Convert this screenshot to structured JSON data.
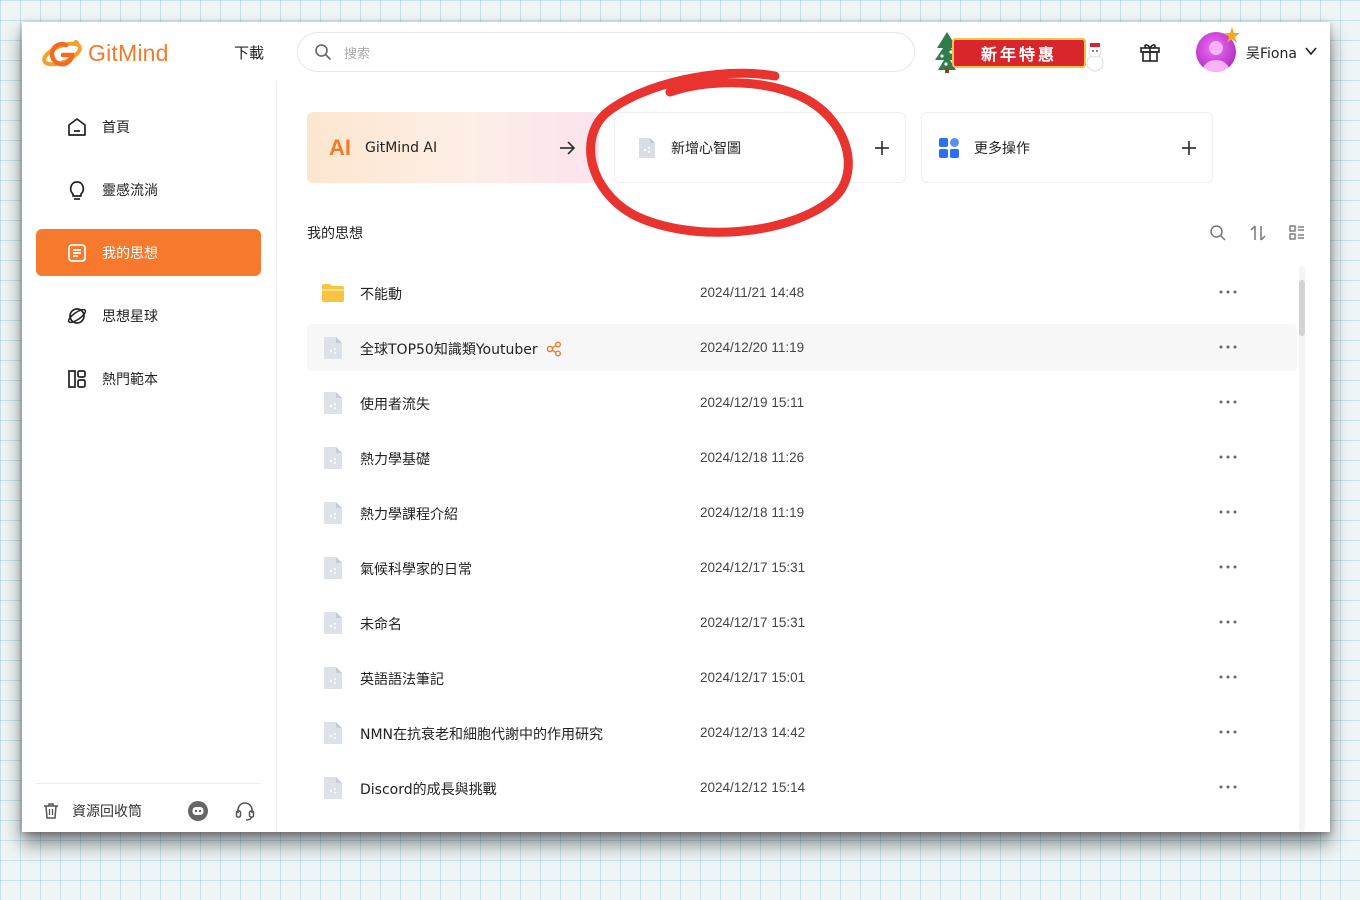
{
  "header": {
    "logo_text": "GitMind",
    "download_label": "下載",
    "search_placeholder": "搜索",
    "promo_label": "新年特惠",
    "username": "吴Fiona"
  },
  "sidebar": {
    "items": [
      {
        "label": "首頁",
        "icon": "home-icon",
        "active": false
      },
      {
        "label": "靈感流淌",
        "icon": "lightbulb-icon",
        "active": false
      },
      {
        "label": "我的思想",
        "icon": "document-icon",
        "active": true
      },
      {
        "label": "思想星球",
        "icon": "planet-icon",
        "active": false
      },
      {
        "label": "熱門範本",
        "icon": "template-icon",
        "active": false
      }
    ],
    "trash_label": "資源回收筒"
  },
  "cards": {
    "ai_logo": "AI",
    "ai_label": "GitMind AI",
    "new_label": "新增心智圖",
    "more_label": "更多操作"
  },
  "section": {
    "title": "我的思想"
  },
  "files": [
    {
      "name": "不能動",
      "date": "2024/11/21 14:48",
      "type": "folder"
    },
    {
      "name": "全球TOP50知識類Youtuber",
      "date": "2024/12/20 11:19",
      "type": "mindmap",
      "shared": true,
      "highlighted": true
    },
    {
      "name": "使用者流失",
      "date": "2024/12/19 15:11",
      "type": "mindmap"
    },
    {
      "name": "熱力學基礎",
      "date": "2024/12/18 11:26",
      "type": "mindmap"
    },
    {
      "name": "熱力學課程介紹",
      "date": "2024/12/18 11:19",
      "type": "mindmap"
    },
    {
      "name": "氣候科學家的日常",
      "date": "2024/12/17 15:31",
      "type": "mindmap"
    },
    {
      "name": "未命名",
      "date": "2024/12/17 15:31",
      "type": "mindmap"
    },
    {
      "name": "英語語法筆記",
      "date": "2024/12/17 15:01",
      "type": "mindmap"
    },
    {
      "name": "NMN在抗衰老和細胞代謝中的作用研究",
      "date": "2024/12/13 14:42",
      "type": "mindmap"
    },
    {
      "name": "Discord的成長與挑戰",
      "date": "2024/12/12 15:14",
      "type": "mindmap"
    }
  ],
  "colors": {
    "accent": "#f7792e",
    "annotation_red": "#e8332f"
  }
}
